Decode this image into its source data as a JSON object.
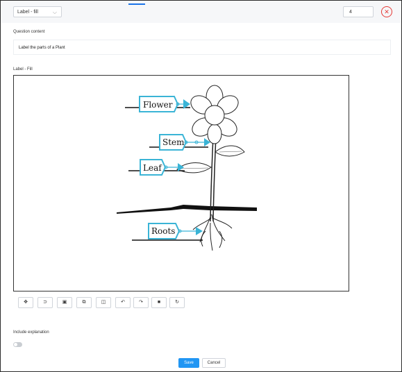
{
  "header": {
    "type_select_value": "Label - fill",
    "number_value": "4",
    "close_symbol": "✕"
  },
  "question": {
    "section_label": "Question content",
    "content_text": "Label the parts of a Plant"
  },
  "canvas": {
    "section_label": "Label - Fill",
    "labels": [
      "Flower",
      "Stem",
      "Leaf",
      "Roots"
    ],
    "accent_color": "#3ab4d6"
  },
  "toolbar": {
    "tools": [
      {
        "name": "move-icon",
        "glyph": "✥"
      },
      {
        "name": "lasso-icon",
        "glyph": "⊃"
      },
      {
        "name": "image-icon",
        "glyph": "▣"
      },
      {
        "name": "duplicate-icon",
        "glyph": "⧉"
      },
      {
        "name": "layers-icon",
        "glyph": "◫"
      },
      {
        "name": "undo-icon",
        "glyph": "↶"
      },
      {
        "name": "redo-icon",
        "glyph": "↷"
      },
      {
        "name": "delete-icon",
        "glyph": "■"
      },
      {
        "name": "reset-icon",
        "glyph": "↻"
      }
    ]
  },
  "explanation": {
    "label": "Include explanation",
    "enabled": false
  },
  "footer": {
    "save_label": "Save",
    "cancel_label": "Cancel"
  }
}
